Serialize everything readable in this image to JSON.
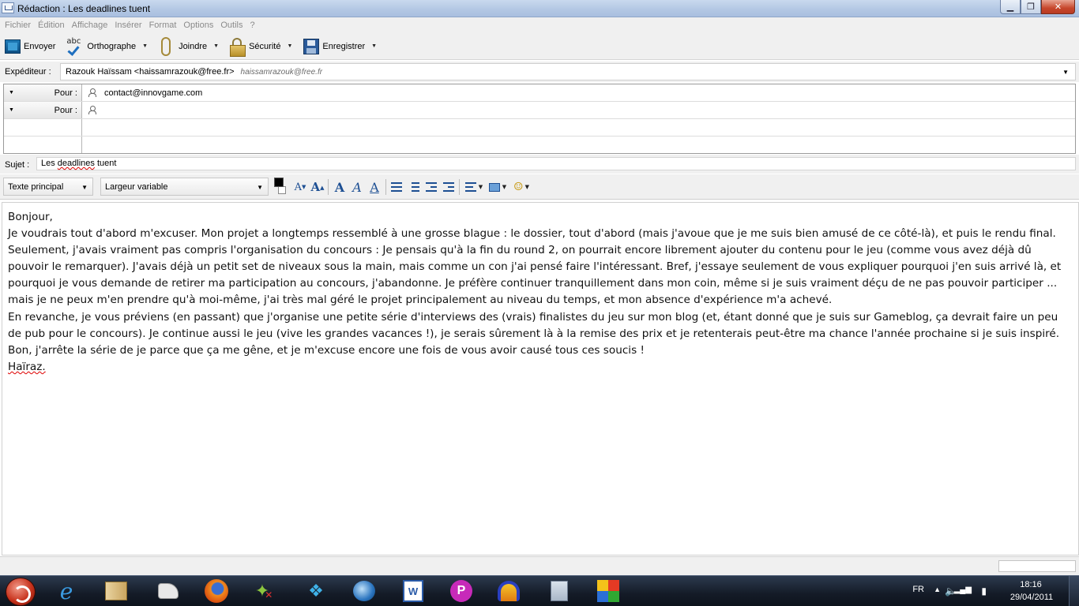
{
  "window": {
    "title": "Rédaction : Les deadlines tuent",
    "min_label": "▁",
    "max_label": "❐",
    "close_label": "✕"
  },
  "menu": [
    "Fichier",
    "Édition",
    "Affichage",
    "Insérer",
    "Format",
    "Options",
    "Outils",
    "?"
  ],
  "toolbar": {
    "send": "Envoyer",
    "spelling": "Orthographe",
    "attach": "Joindre",
    "security": "Sécurité",
    "save": "Enregistrer",
    "spell_abc": "abc"
  },
  "sender": {
    "label": "Expéditeur :",
    "name": "Razouk Haïssam <haissamrazouk@free.fr>",
    "alt": "haissamrazouk@free.fr"
  },
  "recipients": [
    {
      "type": "Pour :",
      "address": "contact@innovgame.com"
    },
    {
      "type": "Pour :",
      "address": ""
    }
  ],
  "subject": {
    "label": "Sujet :",
    "before": "Les ",
    "misspelled": "deadlines",
    "after": " tuent"
  },
  "format": {
    "paragraph_style": "Texte principal",
    "font": "Largeur variable"
  },
  "body": {
    "lines": [
      "Bonjour,",
      "Je voudrais tout d'abord m'excuser. Mon projet a longtemps ressemblé à une grosse blague : le dossier, tout d'abord (mais j'avoue que je me suis bien amusé de ce côté-là), et puis le rendu final.",
      "Seulement, j'avais vraiment pas compris l'organisation du concours : Je pensais qu'à la fin du round 2, on pourrait encore librement ajouter du contenu pour le jeu (comme vous avez déjà dû",
      "pouvoir le remarquer). J'avais déjà un petit set de niveaux sous la main, mais comme un con j'ai pensé faire l'intéressant. Bref, j'essaye seulement de vous expliquer pourquoi j'en suis arrivé là, et",
      "pourquoi je vous demande de retirer ma participation au concours, j'abandonne. Je préfère continuer tranquillement dans mon coin, même si je suis vraiment déçu de ne pas pouvoir participer ...",
      "mais je ne peux m'en prendre qu'à moi-même, j'ai très mal géré le projet principalement au niveau du temps, et mon absence d'expérience m'a achevé.",
      "En revanche, je vous préviens (en passant) que j'organise une petite série d'interviews des (vrais) finalistes du jeu sur mon blog (et, étant donné que je suis sur Gameblog, ça devrait faire un peu",
      "de pub pour le concours). Je continue aussi le jeu (vive les grandes vacances !), je serais sûrement là à la remise des prix et je retenterais peut-être ma chance l'année prochaine si je suis inspiré.",
      "Bon, j'arrête la série de je parce que ça me gêne, et je m'excuse encore une fois de vous avoir causé tous ces soucis !"
    ],
    "signature": "Haïraz."
  },
  "taskbar": {
    "apps": [
      "start",
      "internet-explorer",
      "windows-explorer",
      "paint",
      "firefox",
      "messenger",
      "twitter-client",
      "thunderbird",
      "word",
      "picasa",
      "audacity",
      "calculator",
      "media-player"
    ],
    "lang": "FR",
    "time": "18:16",
    "date": "29/04/2011"
  },
  "colors": {
    "titlebar": "#b4c8e4",
    "chrome": "#f0f0f0",
    "taskbar": "#141b27",
    "accent": "#1d4f93"
  }
}
